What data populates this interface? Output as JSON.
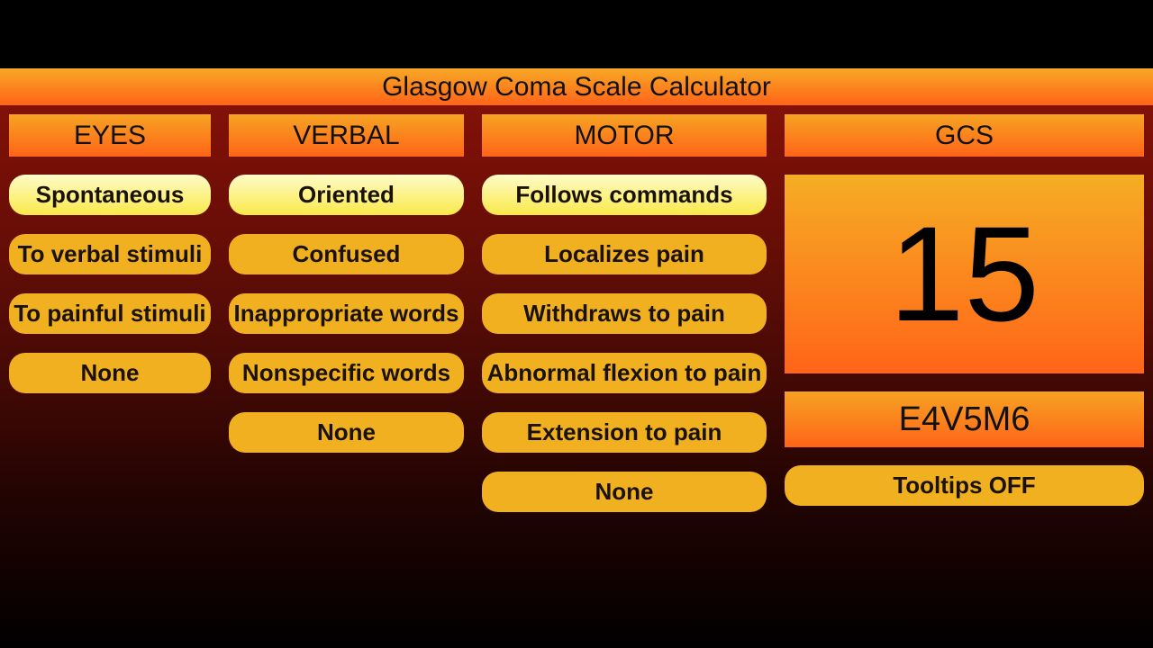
{
  "title": "Glasgow Coma Scale Calculator",
  "columns": [
    {
      "header": "EYES",
      "options": [
        "Spontaneous",
        "To verbal stimuli",
        "To painful stimuli",
        "None"
      ],
      "selected": 0
    },
    {
      "header": "VERBAL",
      "options": [
        "Oriented",
        "Confused",
        "Inappropriate words",
        "Nonspecific words",
        "None"
      ],
      "selected": 0
    },
    {
      "header": "MOTOR",
      "options": [
        "Follows commands",
        "Localizes pain",
        "Withdraws to pain",
        "Abnormal flexion to pain",
        "Extension to pain",
        "None"
      ],
      "selected": 0
    }
  ],
  "gcs": {
    "header": "GCS",
    "score": "15",
    "code": "E4V5M6",
    "tooltips_label": "Tooltips OFF"
  }
}
